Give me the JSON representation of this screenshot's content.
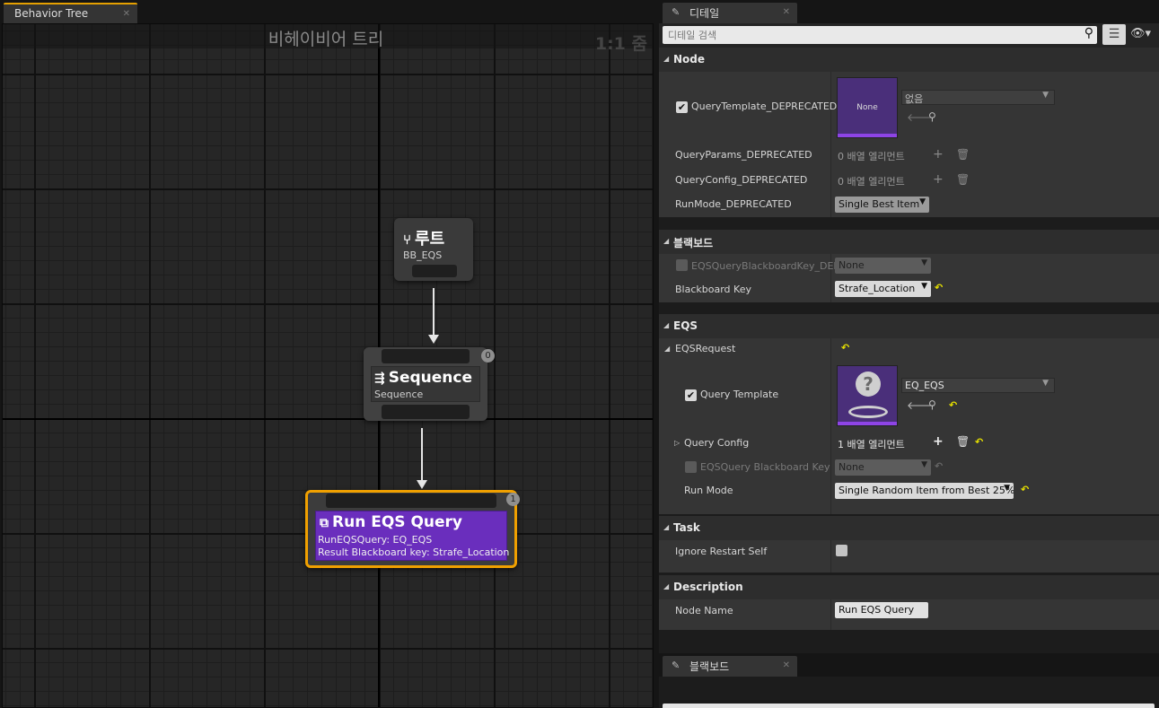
{
  "left": {
    "tab_label": "Behavior Tree",
    "graph_title": "비헤이비어 트리",
    "zoom_label": "1:1 줌",
    "nodes": {
      "root": {
        "title": "루트",
        "subtitle": "BB_EQS"
      },
      "sequence": {
        "title": "Sequence",
        "subtitle": "Sequence",
        "badge": "0"
      },
      "eqs": {
        "title": "Run EQS Query",
        "line1": "RunEQSQuery: EQ_EQS",
        "line2": "Result Blackboard key: Strafe_Location",
        "badge": "1"
      }
    }
  },
  "details": {
    "tab_label": "디테일",
    "search_placeholder": "디테일 검색",
    "categories": {
      "node": "Node",
      "blackboard": "블랙보드",
      "eqs": "EQS",
      "task": "Task",
      "description": "Description"
    },
    "node": {
      "query_template_label": "QueryTemplate_DEPRECATED",
      "thumb_none": "None",
      "none_combo": "없음",
      "query_params_label": "QueryParams_DEPRECATED",
      "query_params_value": "0 배열 엘리먼트",
      "query_config_label": "QueryConfig_DEPRECATED",
      "query_config_value": "0 배열 엘리먼트",
      "run_mode_label": "RunMode_DEPRECATED",
      "run_mode_value": "Single Best Item"
    },
    "blackboard": {
      "eqs_bb_key_label": "EQSQueryBlackboardKey_DEPI",
      "eqs_bb_key_value": "None",
      "bb_key_label": "Blackboard Key",
      "bb_key_value": "Strafe_Location"
    },
    "eqs": {
      "request_label": "EQSRequest",
      "query_template_label": "Query Template",
      "query_template_value": "EQ_EQS",
      "query_config_label": "Query Config",
      "query_config_value": "1 배열 엘리먼트",
      "eqs_bb_key_label": "EQSQuery Blackboard Key",
      "eqs_bb_key_value": "None",
      "run_mode_label": "Run Mode",
      "run_mode_value": "Single Random Item from Best 25%"
    },
    "task": {
      "ignore_restart_label": "Ignore Restart Self"
    },
    "description": {
      "node_name_label": "Node Name",
      "node_name_value": "Run EQS Query"
    }
  },
  "blackboard_panel": {
    "tab_label": "블랙보드"
  }
}
